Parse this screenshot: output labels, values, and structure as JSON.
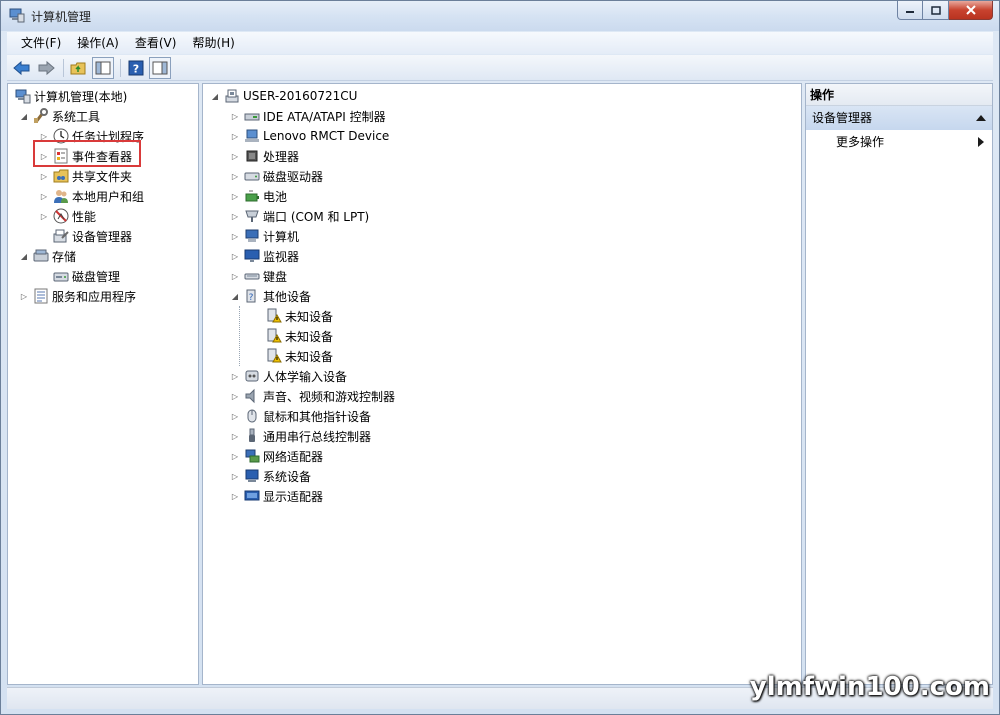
{
  "window": {
    "title": "计算机管理"
  },
  "menu": [
    "文件(F)",
    "操作(A)",
    "查看(V)",
    "帮助(H)"
  ],
  "left_tree": {
    "root": "计算机管理(本地)",
    "system_tools": "系统工具",
    "task_scheduler": "任务计划程序",
    "event_viewer": "事件查看器",
    "shared_folders": "共享文件夹",
    "local_users": "本地用户和组",
    "performance": "性能",
    "device_manager": "设备管理器",
    "storage": "存储",
    "disk_management": "磁盘管理",
    "services_apps": "服务和应用程序"
  },
  "device_tree": {
    "computer_name": "USER-20160721CU",
    "categories": [
      "IDE ATA/ATAPI 控制器",
      "Lenovo RMCT Device",
      "处理器",
      "磁盘驱动器",
      "电池",
      "端口 (COM 和 LPT)",
      "计算机",
      "监视器",
      "键盘",
      "其他设备",
      "人体学输入设备",
      "声音、视频和游戏控制器",
      "鼠标和其他指针设备",
      "通用串行总线控制器",
      "网络适配器",
      "系统设备",
      "显示适配器"
    ],
    "unknown_devices": [
      "未知设备",
      "未知设备",
      "未知设备"
    ]
  },
  "actions": {
    "header": "操作",
    "section": "设备管理器",
    "more": "更多操作"
  },
  "watermark": "ylmfwin100.com"
}
